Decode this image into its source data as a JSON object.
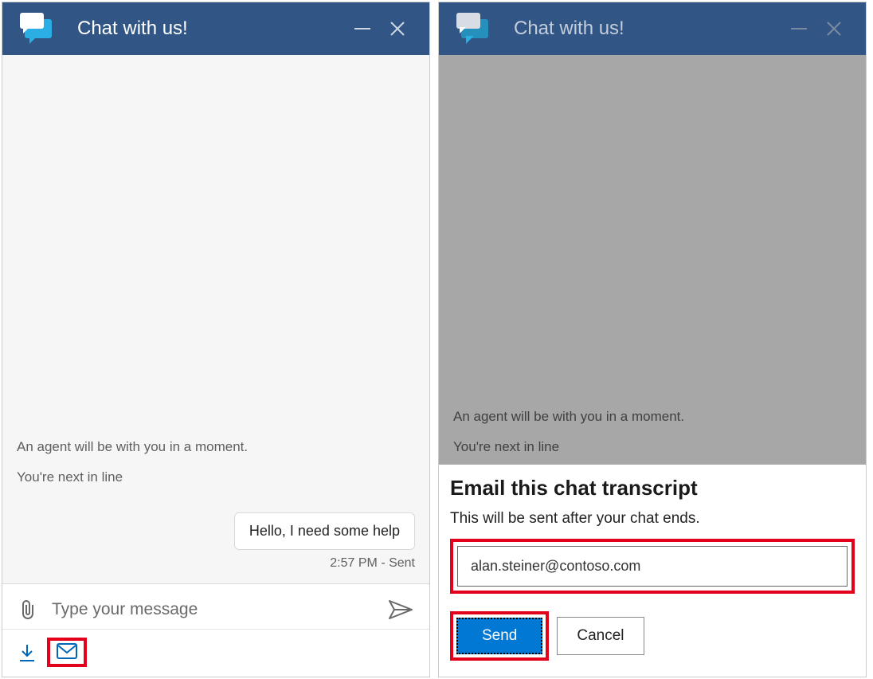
{
  "left": {
    "header": {
      "title": "Chat with us!"
    },
    "system_messages": [
      "An agent will be with you in a moment.",
      "You're next in line"
    ],
    "user_message": "Hello, I need some help",
    "user_message_meta": "2:57 PM - Sent",
    "composer": {
      "placeholder": "Type your message"
    }
  },
  "right": {
    "header": {
      "title": "Chat with us!"
    },
    "system_messages": [
      "An agent will be with you in a moment.",
      "You're next in line"
    ],
    "dialog": {
      "title": "Email this chat transcript",
      "subtitle": "This will be sent after your chat ends.",
      "email_value": "alan.steiner@contoso.com",
      "send_label": "Send",
      "cancel_label": "Cancel"
    }
  }
}
